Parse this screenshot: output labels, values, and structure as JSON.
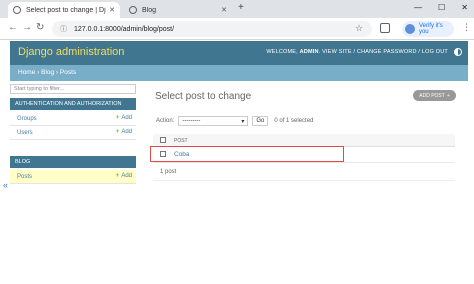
{
  "browser": {
    "tabs": [
      {
        "title": "Select post to change | Django",
        "active": true
      },
      {
        "title": "Blog",
        "active": false
      }
    ],
    "new_tab": "+",
    "window_controls": [
      "—",
      "☐",
      "✕"
    ],
    "url": "127.0.0.1:8000/admin/blog/post/",
    "profile_label": "Verify it's you"
  },
  "django": {
    "brand": "Django administration",
    "welcome": "WELCOME,",
    "user": "ADMIN",
    "tools": ". VIEW SITE / CHANGE PASSWORD / LOG OUT",
    "breadcrumbs": "Home › Blog › Posts",
    "colors": {
      "header": "#417690",
      "brand": "#f5dd5d",
      "crumbs": "#79aec8",
      "link": "#447e9b",
      "highlight": "#e04a4a"
    }
  },
  "sidebar": {
    "filter_placeholder": "Start typing to filter...",
    "apps": [
      {
        "caption": "AUTHENTICATION AND AUTHORIZATION",
        "models": [
          {
            "label": "Groups",
            "add": "Add"
          },
          {
            "label": "Users",
            "add": "Add"
          }
        ]
      },
      {
        "caption": "BLOG",
        "models": [
          {
            "label": "Posts",
            "add": "Add",
            "active": true
          }
        ]
      }
    ],
    "collapse_icon": "«"
  },
  "content": {
    "title": "Select post to change",
    "add_button": "ADD POST",
    "add_icon": "+",
    "action_label": "Action:",
    "action_value": "---------",
    "go_label": "Go",
    "selected_count": "0 of 1 selected",
    "column_header": "POST",
    "rows": [
      "Coba"
    ],
    "result_count": "1 post"
  }
}
